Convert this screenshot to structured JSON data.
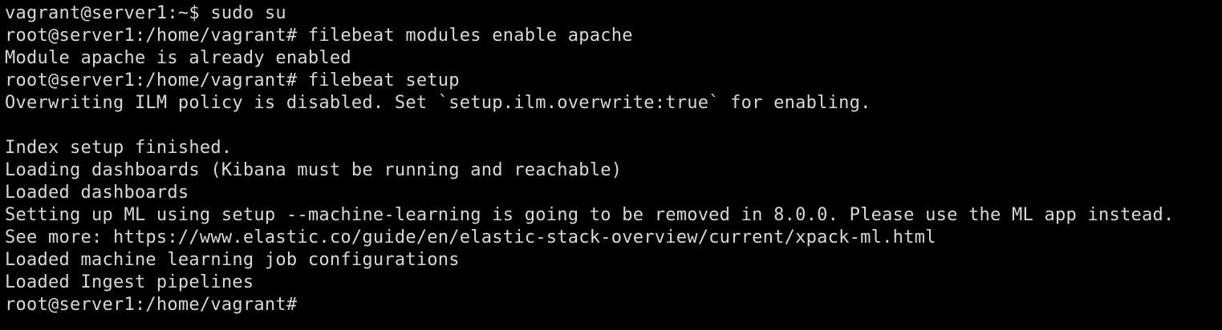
{
  "terminal": {
    "lines": [
      "vagrant@server1:~$ sudo su",
      "root@server1:/home/vagrant# filebeat modules enable apache",
      "Module apache is already enabled",
      "root@server1:/home/vagrant# filebeat setup",
      "Overwriting ILM policy is disabled. Set `setup.ilm.overwrite:true` for enabling.",
      "",
      "Index setup finished.",
      "Loading dashboards (Kibana must be running and reachable)",
      "Loaded dashboards",
      "Setting up ML using setup --machine-learning is going to be removed in 8.0.0. Please use the ML app instead.",
      "See more: https://www.elastic.co/guide/en/elastic-stack-overview/current/xpack-ml.html",
      "Loaded machine learning job configurations",
      "Loaded Ingest pipelines",
      "root@server1:/home/vagrant# "
    ]
  }
}
